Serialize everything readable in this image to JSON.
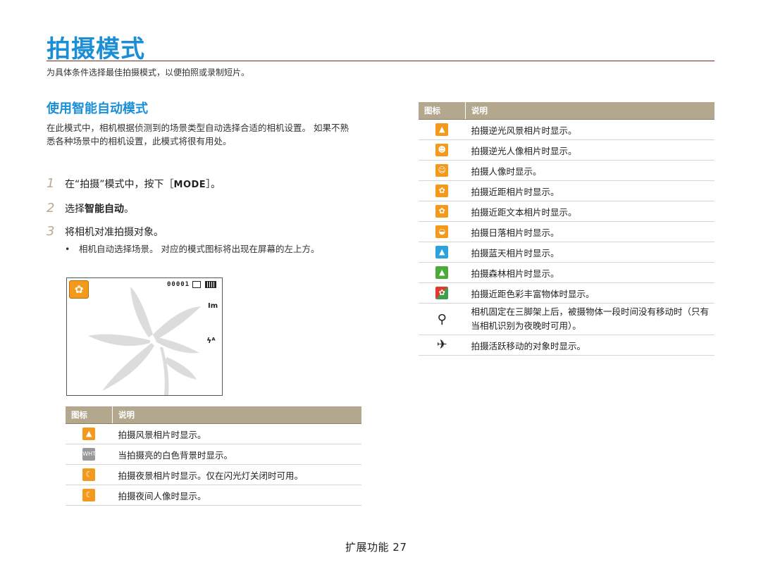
{
  "page": {
    "title": "拍摄模式",
    "intro": "为具体条件选择最佳拍摄模式，以便拍照或录制短片。",
    "footer_section": "扩展功能",
    "page_number": "27"
  },
  "section": {
    "title": "使用智能自动模式",
    "body": "在此模式中，相机根据侦测到的场景类型自动选择合适的相机设置。 如果不熟悉各种场景中的相机设置，此模式将很有用处。"
  },
  "steps": [
    {
      "num": "1",
      "pre": "在“拍摄”模式中，按下［",
      "key": "MODE",
      "post": "］。"
    },
    {
      "num": "2",
      "pre": "选择",
      "bold": "智能自动",
      "post": "。"
    },
    {
      "num": "3",
      "text": "将相机对准拍摄对象。"
    }
  ],
  "bullet": "相机自动选择场景。 对应的模式图标将出现在屏幕的左上方。",
  "preview": {
    "counter": "00001",
    "mode_icon": "flower-macro-icon",
    "size_glyph": "Im",
    "flash_glyph": "ϟᴬ"
  },
  "table_headers": {
    "icon": "图标",
    "desc": "说明"
  },
  "left_table": [
    {
      "icon": "landscape-icon",
      "color": "orange",
      "glyph": "▲",
      "desc": "拍摄风景相片时显示。"
    },
    {
      "icon": "white-background-icon",
      "color": "gray",
      "glyph": "WHT",
      "desc": "当拍摄亮的白色背景时显示。"
    },
    {
      "icon": "night-icon",
      "color": "orange",
      "glyph": "☾",
      "desc": "拍摄夜景相片时显示。仅在闪光灯关闭时可用。"
    },
    {
      "icon": "night-portrait-icon",
      "color": "orange",
      "glyph": "☾",
      "desc": "拍摄夜间人像时显示。"
    }
  ],
  "right_table": [
    {
      "icon": "backlit-landscape-icon",
      "color": "orange",
      "glyph": "▲",
      "desc": "拍摄逆光风景相片时显示。"
    },
    {
      "icon": "backlit-portrait-icon",
      "color": "orange",
      "glyph": "☻",
      "desc": "拍摄逆光人像相片时显示。"
    },
    {
      "icon": "portrait-icon",
      "color": "orange",
      "glyph": "☺",
      "desc": "拍摄人像时显示。"
    },
    {
      "icon": "macro-icon",
      "color": "orange",
      "glyph": "✿",
      "desc": "拍摄近距相片时显示。"
    },
    {
      "icon": "macro-text-icon",
      "color": "orange",
      "glyph": "✿",
      "desc": "拍摄近距文本相片时显示。"
    },
    {
      "icon": "sunset-icon",
      "color": "orange",
      "glyph": "◒",
      "desc": "拍摄日落相片时显示。"
    },
    {
      "icon": "blue-sky-icon",
      "color": "blue",
      "glyph": "▲",
      "desc": "拍摄蓝天相片时显示。"
    },
    {
      "icon": "forest-icon",
      "color": "green",
      "glyph": "▲",
      "desc": "拍摄森林相片时显示。"
    },
    {
      "icon": "macro-color-icon",
      "color": "red",
      "glyph": "✿",
      "desc": "拍摄近距色彩丰富物体时显示。"
    },
    {
      "icon": "tripod-icon",
      "color": "plain",
      "glyph": "⚲",
      "desc": "相机固定在三脚架上后，被摄物体一段时间没有移动时（只有当相机识别为夜晚时可用）。"
    },
    {
      "icon": "action-icon",
      "color": "plain",
      "glyph": "✈",
      "desc": "拍摄活跃移动的对象时显示。"
    }
  ]
}
